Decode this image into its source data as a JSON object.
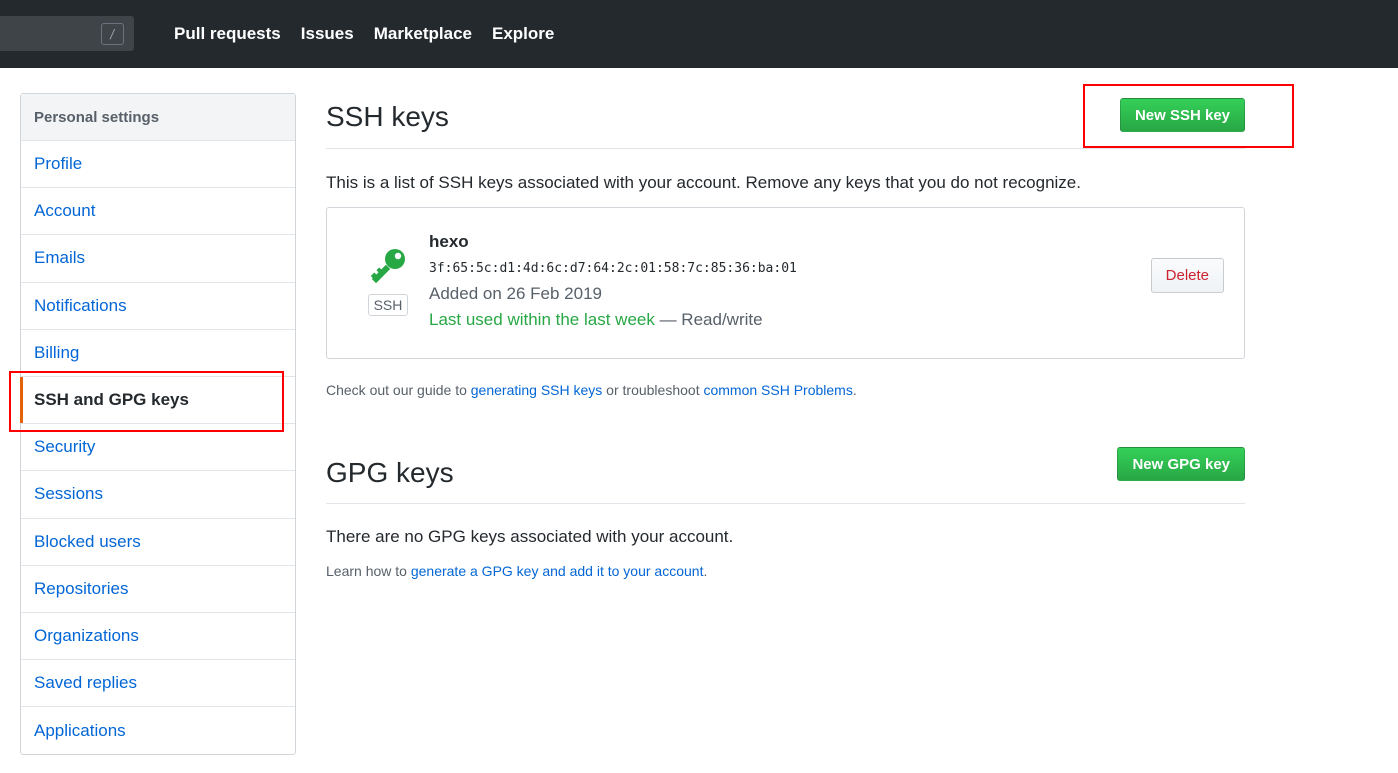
{
  "header": {
    "search_slash": "/",
    "nav": [
      "Pull requests",
      "Issues",
      "Marketplace",
      "Explore"
    ]
  },
  "sidebar": {
    "title": "Personal settings",
    "items": [
      {
        "label": "Profile"
      },
      {
        "label": "Account"
      },
      {
        "label": "Emails"
      },
      {
        "label": "Notifications"
      },
      {
        "label": "Billing"
      },
      {
        "label": "SSH and GPG keys",
        "selected": true
      },
      {
        "label": "Security"
      },
      {
        "label": "Sessions"
      },
      {
        "label": "Blocked users"
      },
      {
        "label": "Repositories"
      },
      {
        "label": "Organizations"
      },
      {
        "label": "Saved replies"
      },
      {
        "label": "Applications"
      }
    ]
  },
  "ssh": {
    "title": "SSH keys",
    "new_button": "New SSH key",
    "intro": "This is a list of SSH keys associated with your account. Remove any keys that you do not recognize.",
    "key": {
      "title": "hexo",
      "fingerprint": "3f:65:5c:d1:4d:6c:d7:64:2c:01:58:7c:85:36:ba:01",
      "added": "Added on 26 Feb 2019",
      "last_used": "Last used within the last week",
      "access": " — Read/write",
      "badge": "SSH",
      "delete_button": "Delete"
    },
    "guide_prefix": "Check out our guide to ",
    "guide_link1": "generating SSH keys",
    "guide_middle": " or troubleshoot ",
    "guide_link2": "common SSH Problems",
    "guide_suffix": "."
  },
  "gpg": {
    "title": "GPG keys",
    "new_button": "New GPG key",
    "empty": "There are no GPG keys associated with your account.",
    "learn_prefix": "Learn how to ",
    "learn_link": "generate a GPG key and add it to your account",
    "learn_suffix": "."
  },
  "colors": {
    "header_bg": "#24292e",
    "link": "#0366d6",
    "green": "#28a745",
    "selected_bar": "#e36209",
    "annotation": "#ff0000"
  }
}
